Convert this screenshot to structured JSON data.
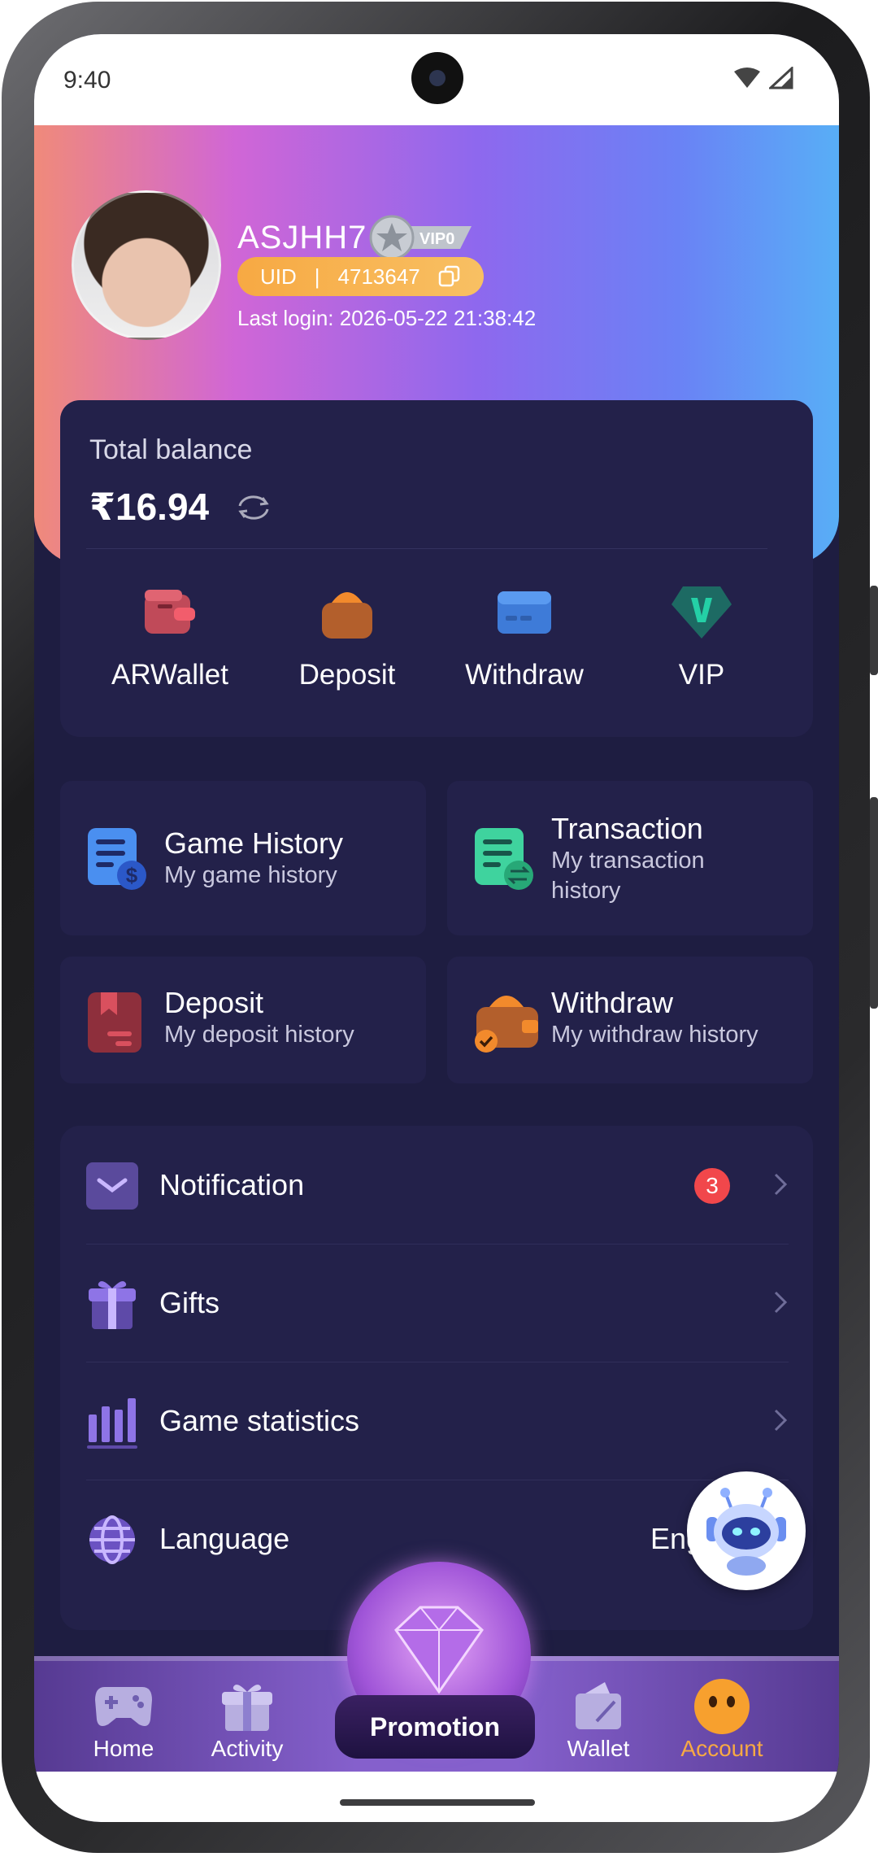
{
  "status_bar": {
    "time": "9:40"
  },
  "profile": {
    "username": "ASJHH7",
    "vip_badge": "VIP0",
    "uid_label": "UID",
    "uid_separator": "|",
    "uid_value": "4713647",
    "last_login": "Last login: 2026-05-22 21:38:42"
  },
  "balance": {
    "title": "Total balance",
    "amount": "₹16.94",
    "actions": [
      {
        "label": "ARWallet",
        "icon": "wallet-icon"
      },
      {
        "label": "Deposit",
        "icon": "deposit-bag-icon"
      },
      {
        "label": "Withdraw",
        "icon": "card-icon"
      },
      {
        "label": "VIP",
        "icon": "vip-gem-icon"
      }
    ]
  },
  "history": {
    "game": {
      "title": "Game History",
      "subtitle": "My game history"
    },
    "transaction": {
      "title": "Transaction",
      "subtitle_1": "My transaction",
      "subtitle_2": "history"
    },
    "deposit": {
      "title": "Deposit",
      "subtitle": "My deposit history"
    },
    "withdraw": {
      "title": "Withdraw",
      "subtitle": "My withdraw history"
    }
  },
  "settings": {
    "notification": {
      "label": "Notification",
      "badge": "3"
    },
    "gifts": {
      "label": "Gifts"
    },
    "game_statistics": {
      "label": "Game statistics"
    },
    "language": {
      "label": "Language",
      "value": "Engl"
    }
  },
  "nav": {
    "home": "Home",
    "activity": "Activity",
    "promotion": "Promotion",
    "wallet": "Wallet",
    "account": "Account",
    "active": "account"
  },
  "colors": {
    "background": "#1e1d41",
    "card": "#23214a",
    "accent_orange": "#f7a943",
    "badge_red": "#f1474b",
    "active_nav": "#f7a943"
  }
}
